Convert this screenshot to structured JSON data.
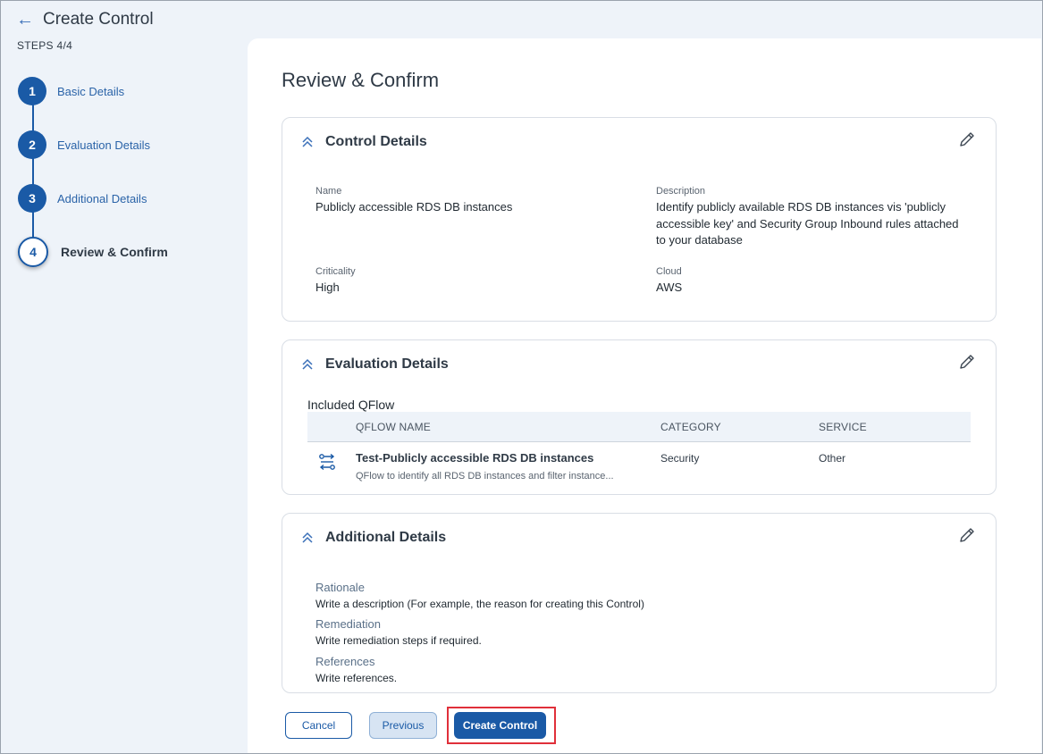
{
  "header": {
    "title": "Create Control",
    "steps_label": "STEPS 4/4"
  },
  "stepper": [
    {
      "number": "1",
      "label": "Basic Details"
    },
    {
      "number": "2",
      "label": "Evaluation Details"
    },
    {
      "number": "3",
      "label": "Additional Details"
    },
    {
      "number": "4",
      "label": "Review & Confirm"
    }
  ],
  "main": {
    "title": "Review & Confirm"
  },
  "control_details": {
    "title": "Control Details",
    "name_label": "Name",
    "name_value": "Publicly accessible RDS DB instances",
    "description_label": "Description",
    "description_value": "Identify publicly available RDS DB instances vis 'publicly accessible key' and Security Group Inbound rules attached to your database",
    "criticality_label": "Criticality",
    "criticality_value": "High",
    "cloud_label": "Cloud",
    "cloud_value": "AWS"
  },
  "evaluation_details": {
    "title": "Evaluation Details",
    "included_label": "Included QFlow",
    "columns": [
      "QFLOW NAME",
      "CATEGORY",
      "SERVICE"
    ],
    "rows": [
      {
        "name": "Test-Publicly accessible RDS DB instances",
        "description": "QFlow to identify all RDS DB instances and filter instance...",
        "category": "Security",
        "service": "Other"
      }
    ]
  },
  "additional_details": {
    "title": "Additional Details",
    "rationale_label": "Rationale",
    "rationale_value": "Write a description (For example, the reason for creating this Control)",
    "remediation_label": "Remediation",
    "remediation_value": "Write remediation steps if required.",
    "references_label": "References",
    "references_value": "Write references."
  },
  "buttons": {
    "cancel": "Cancel",
    "previous": "Previous",
    "create": "Create Control"
  },
  "colors": {
    "primary": "#1a5aa6",
    "highlight": "#e0303a",
    "background": "#eef3f9"
  }
}
